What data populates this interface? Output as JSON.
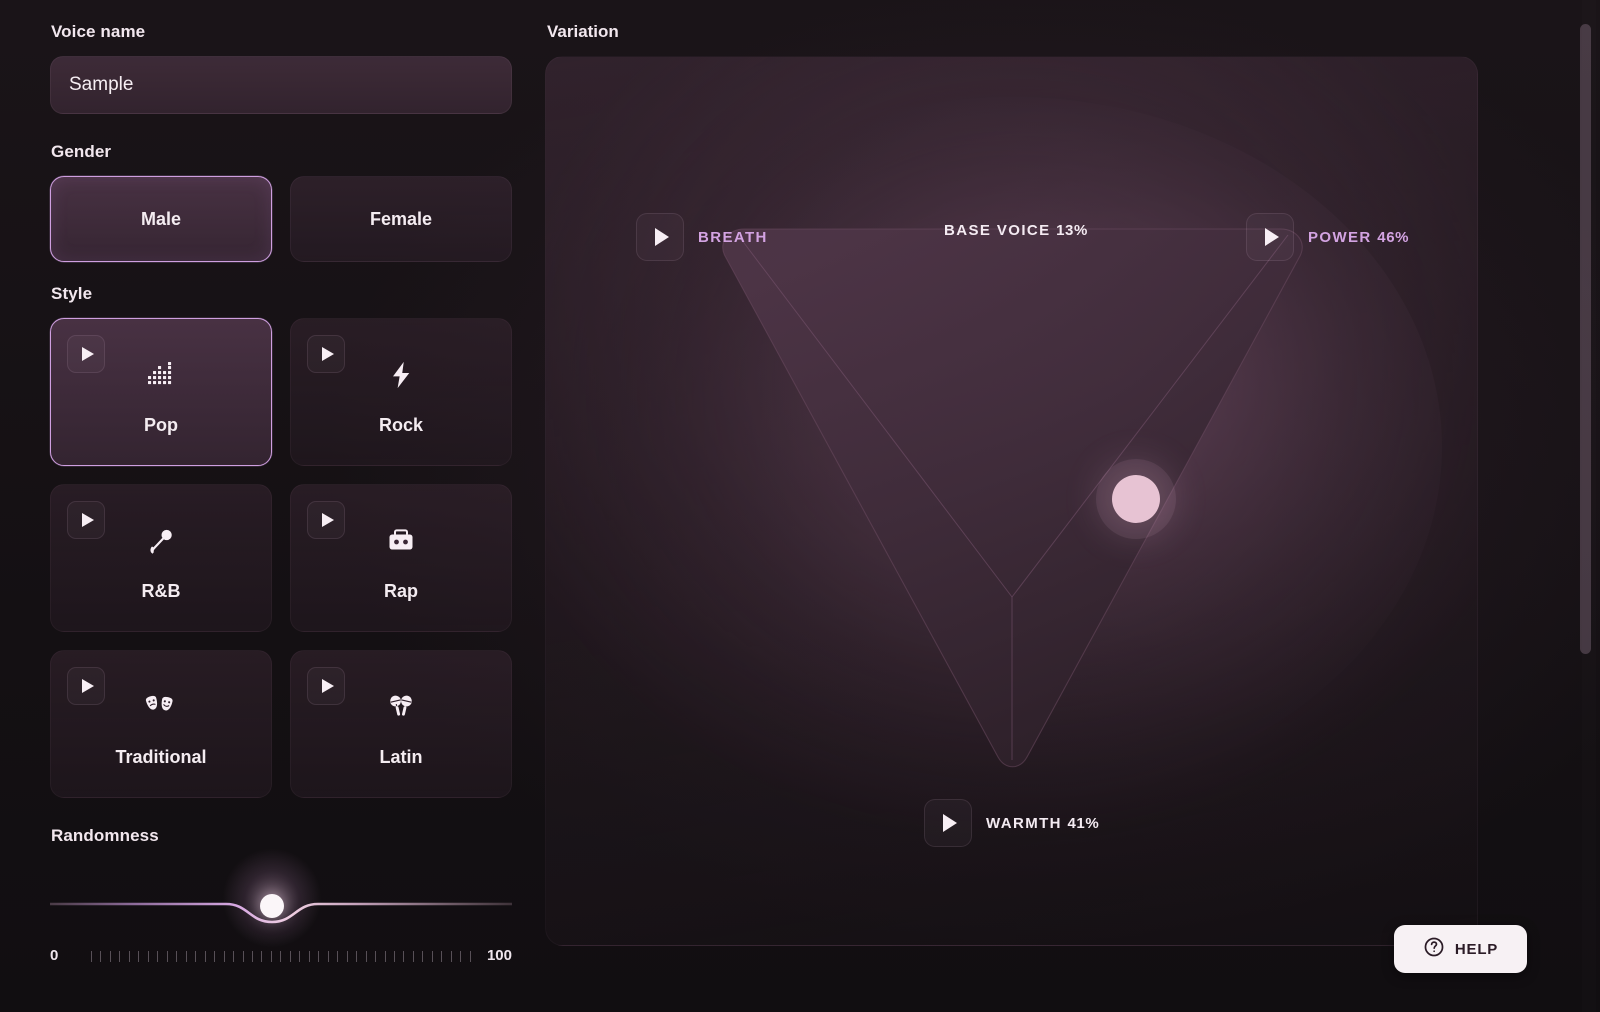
{
  "voice_name": {
    "label": "Voice name",
    "value": "Sample",
    "placeholder": "Voice name"
  },
  "gender": {
    "label": "Gender",
    "selected": "Male",
    "options": [
      {
        "label": "Male",
        "selected": true
      },
      {
        "label": "Female",
        "selected": false
      }
    ]
  },
  "style": {
    "label": "Style",
    "selected": "Pop",
    "options": [
      {
        "label": "Pop",
        "icon": "equalizer-icon",
        "selected": true
      },
      {
        "label": "Rock",
        "icon": "lightning-bolt-icon",
        "selected": false
      },
      {
        "label": "R&B",
        "icon": "microphone-icon",
        "selected": false
      },
      {
        "label": "Rap",
        "icon": "boombox-icon",
        "selected": false
      },
      {
        "label": "Traditional",
        "icon": "theater-masks-icon",
        "selected": false
      },
      {
        "label": "Latin",
        "icon": "maracas-icon",
        "selected": false
      }
    ]
  },
  "randomness": {
    "label": "Randomness",
    "min_label": "0",
    "max_label": "100",
    "min": 0,
    "max": 100,
    "value": 48,
    "tick_count": 41
  },
  "variation": {
    "label": "Variation",
    "axes": [
      {
        "name": "BREATH",
        "value_text": "",
        "accent": true,
        "has_play": true,
        "position": "top-left"
      },
      {
        "name": "BASE VOICE",
        "value_text": "13%",
        "accent": false,
        "has_play": false,
        "position": "top-center"
      },
      {
        "name": "POWER",
        "value_text": "46%",
        "accent": true,
        "has_play": true,
        "position": "top-right"
      },
      {
        "name": "WARMTH",
        "value_text": "41%",
        "accent": false,
        "has_play": true,
        "position": "bottom-center"
      }
    ],
    "handle": {
      "x_pct": 63.2,
      "y_pct": 49.7
    }
  },
  "help": {
    "label": "HELP",
    "icon": "question-circle-icon"
  },
  "colors": {
    "page_background": "#141013",
    "accent_purple": "#cf9fe0",
    "accent_pink_handle": "#e7c3d3",
    "text_primary": "#f3e9ef",
    "help_background": "#f7f1f4"
  }
}
